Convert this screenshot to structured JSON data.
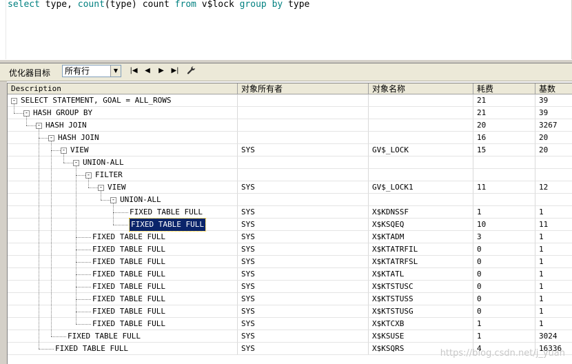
{
  "editor": {
    "sql_tokens": [
      {
        "t": "select",
        "c": "kw"
      },
      {
        "t": " type, ",
        "c": "plain"
      },
      {
        "t": "count",
        "c": "fn"
      },
      {
        "t": "(type) ",
        "c": "plain"
      },
      {
        "t": "count",
        "c": "plain"
      },
      {
        "t": " ",
        "c": "plain"
      },
      {
        "t": "from",
        "c": "kw"
      },
      {
        "t": " v$lock ",
        "c": "plain"
      },
      {
        "t": "group by",
        "c": "kw"
      },
      {
        "t": " type",
        "c": "plain"
      }
    ]
  },
  "toolbar": {
    "optimizer_label": "优化器目标",
    "optimizer_value": "所有行",
    "first_icon": "first-record-icon",
    "prev_icon": "prev-record-icon",
    "next_icon": "next-record-icon",
    "last_icon": "last-record-icon",
    "wrench_icon": "wrench-icon"
  },
  "grid": {
    "columns": [
      "Description",
      "对象所有者",
      "对象名称",
      "耗费",
      "基数"
    ],
    "rows": [
      {
        "desc": "SELECT STATEMENT, GOAL = ALL_ROWS",
        "level": 0,
        "expander": "-",
        "owner": "",
        "name": "",
        "cost": "21",
        "card": "39"
      },
      {
        "desc": "HASH GROUP BY",
        "level": 1,
        "expander": "-",
        "owner": "",
        "name": "",
        "cost": "21",
        "card": "39"
      },
      {
        "desc": "HASH JOIN",
        "level": 2,
        "expander": "-",
        "owner": "",
        "name": "",
        "cost": "20",
        "card": "3267"
      },
      {
        "desc": "HASH JOIN",
        "level": 3,
        "expander": "-",
        "owner": "",
        "name": "",
        "cost": "16",
        "card": "20"
      },
      {
        "desc": "VIEW",
        "level": 4,
        "expander": "-",
        "owner": "SYS",
        "name": "GV$_LOCK",
        "cost": "15",
        "card": "20"
      },
      {
        "desc": "UNION-ALL",
        "level": 5,
        "expander": "-",
        "owner": "",
        "name": "",
        "cost": "",
        "card": ""
      },
      {
        "desc": "FILTER",
        "level": 6,
        "expander": "-",
        "owner": "",
        "name": "",
        "cost": "",
        "card": ""
      },
      {
        "desc": "VIEW",
        "level": 7,
        "expander": "-",
        "owner": "SYS",
        "name": "GV$_LOCK1",
        "cost": "11",
        "card": "12"
      },
      {
        "desc": "UNION-ALL",
        "level": 8,
        "expander": "-",
        "owner": "",
        "name": "",
        "cost": "",
        "card": ""
      },
      {
        "desc": "FIXED TABLE FULL",
        "level": 9,
        "expander": "",
        "owner": "SYS",
        "name": "X$KDNSSF",
        "cost": "1",
        "card": "1"
      },
      {
        "desc": "FIXED TABLE FULL",
        "level": 9,
        "expander": "",
        "owner": "SYS",
        "name": "X$KSQEQ",
        "cost": "10",
        "card": "11",
        "selected": true
      },
      {
        "desc": "FIXED TABLE FULL",
        "level": 6,
        "expander": "",
        "owner": "SYS",
        "name": "X$KTADM",
        "cost": "3",
        "card": "1"
      },
      {
        "desc": "FIXED TABLE FULL",
        "level": 6,
        "expander": "",
        "owner": "SYS",
        "name": "X$KTATRFIL",
        "cost": "0",
        "card": "1"
      },
      {
        "desc": "FIXED TABLE FULL",
        "level": 6,
        "expander": "",
        "owner": "SYS",
        "name": "X$KTATRFSL",
        "cost": "0",
        "card": "1"
      },
      {
        "desc": "FIXED TABLE FULL",
        "level": 6,
        "expander": "",
        "owner": "SYS",
        "name": "X$KTATL",
        "cost": "0",
        "card": "1"
      },
      {
        "desc": "FIXED TABLE FULL",
        "level": 6,
        "expander": "",
        "owner": "SYS",
        "name": "X$KTSTUSC",
        "cost": "0",
        "card": "1"
      },
      {
        "desc": "FIXED TABLE FULL",
        "level": 6,
        "expander": "",
        "owner": "SYS",
        "name": "X$KTSTUSS",
        "cost": "0",
        "card": "1"
      },
      {
        "desc": "FIXED TABLE FULL",
        "level": 6,
        "expander": "",
        "owner": "SYS",
        "name": "X$KTSTUSG",
        "cost": "0",
        "card": "1"
      },
      {
        "desc": "FIXED TABLE FULL",
        "level": 6,
        "expander": "",
        "owner": "SYS",
        "name": "X$KTCXB",
        "cost": "1",
        "card": "1"
      },
      {
        "desc": "FIXED TABLE FULL",
        "level": 4,
        "expander": "",
        "owner": "SYS",
        "name": "X$KSUSE",
        "cost": "1",
        "card": "3024"
      },
      {
        "desc": "FIXED TABLE FULL",
        "level": 3,
        "expander": "",
        "owner": "SYS",
        "name": "X$KSQRS",
        "cost": "4",
        "card": "16336"
      }
    ]
  },
  "watermark": "https://blog.csdn.net/j_yuan"
}
